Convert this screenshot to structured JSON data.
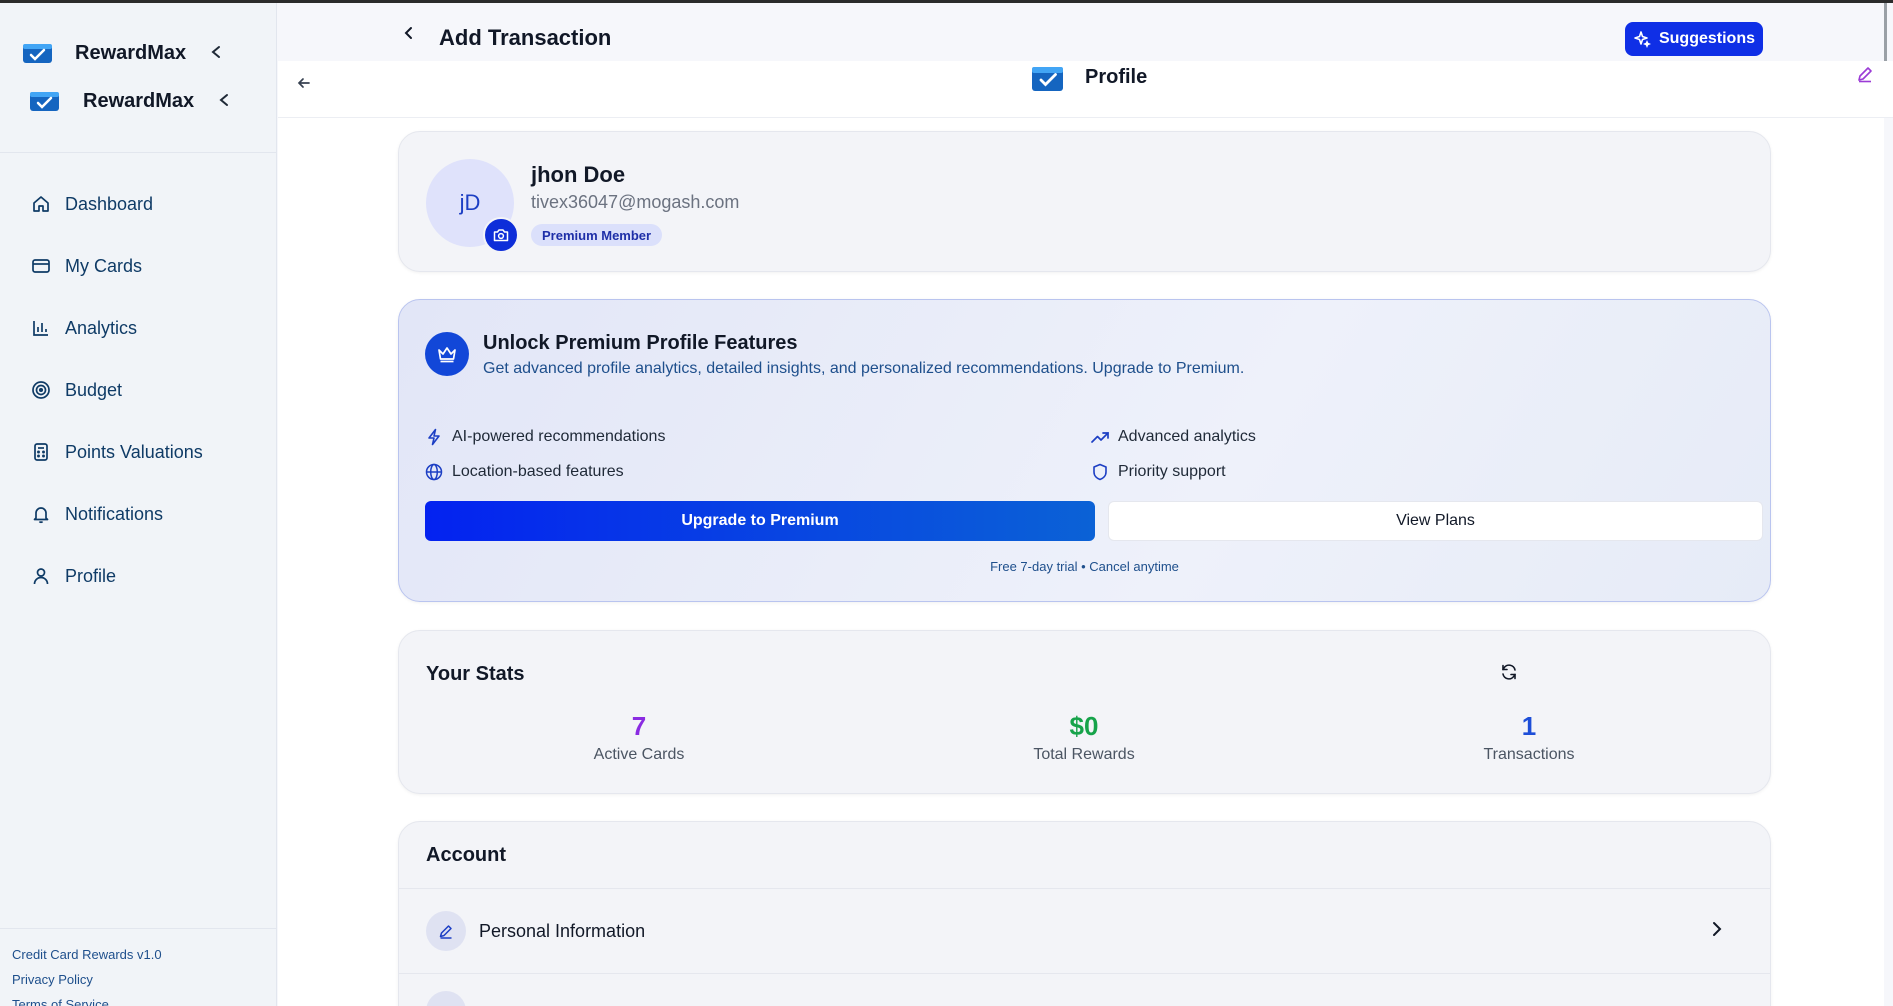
{
  "sidebar": {
    "brand_name": "RewardMax",
    "items": [
      {
        "label": "Dashboard",
        "icon": "home-icon"
      },
      {
        "label": "My Cards",
        "icon": "credit-card-icon"
      },
      {
        "label": "Analytics",
        "icon": "bar-chart-icon"
      },
      {
        "label": "Budget",
        "icon": "target-icon"
      },
      {
        "label": "Points Valuations",
        "icon": "calculator-icon"
      },
      {
        "label": "Notifications",
        "icon": "bell-icon"
      },
      {
        "label": "Profile",
        "icon": "user-icon"
      }
    ],
    "footer": {
      "version": "Credit Card Rewards v1.0",
      "privacy": "Privacy Policy",
      "terms": "Terms of Service"
    }
  },
  "header": {
    "title": "Add Transaction",
    "suggestions_label": "Suggestions"
  },
  "subheader": {
    "title": "Profile"
  },
  "profile": {
    "initials": "jD",
    "name": "jhon Doe",
    "email": "tivex36047@mogash.com",
    "badge": "Premium Member"
  },
  "premium": {
    "title": "Unlock Premium Profile Features",
    "description": "Get advanced profile analytics, detailed insights, and personalized recommendations. Upgrade to Premium.",
    "features": [
      {
        "label": "AI-powered recommendations",
        "icon": "lightning-icon"
      },
      {
        "label": "Advanced analytics",
        "icon": "trending-up-icon"
      },
      {
        "label": "Location-based features",
        "icon": "globe-icon"
      },
      {
        "label": "Priority support",
        "icon": "shield-icon"
      }
    ],
    "upgrade_label": "Upgrade to Premium",
    "plans_label": "View Plans",
    "trial_note": "Free 7-day trial • Cancel anytime"
  },
  "stats": {
    "title": "Your Stats",
    "items": [
      {
        "value": "7",
        "label": "Active Cards",
        "color": "#8a2be2"
      },
      {
        "value": "$0",
        "label": "Total Rewards",
        "color": "#16a34a"
      },
      {
        "value": "1",
        "label": "Transactions",
        "color": "#1d4ed8"
      }
    ]
  },
  "account": {
    "title": "Account",
    "rows": [
      {
        "label": "Personal Information",
        "icon": "pencil-icon"
      }
    ]
  },
  "colors": {
    "accent": "#0f2fe6",
    "nav_text": "#0f3b66",
    "edit_icon": "#9b3bd6"
  }
}
